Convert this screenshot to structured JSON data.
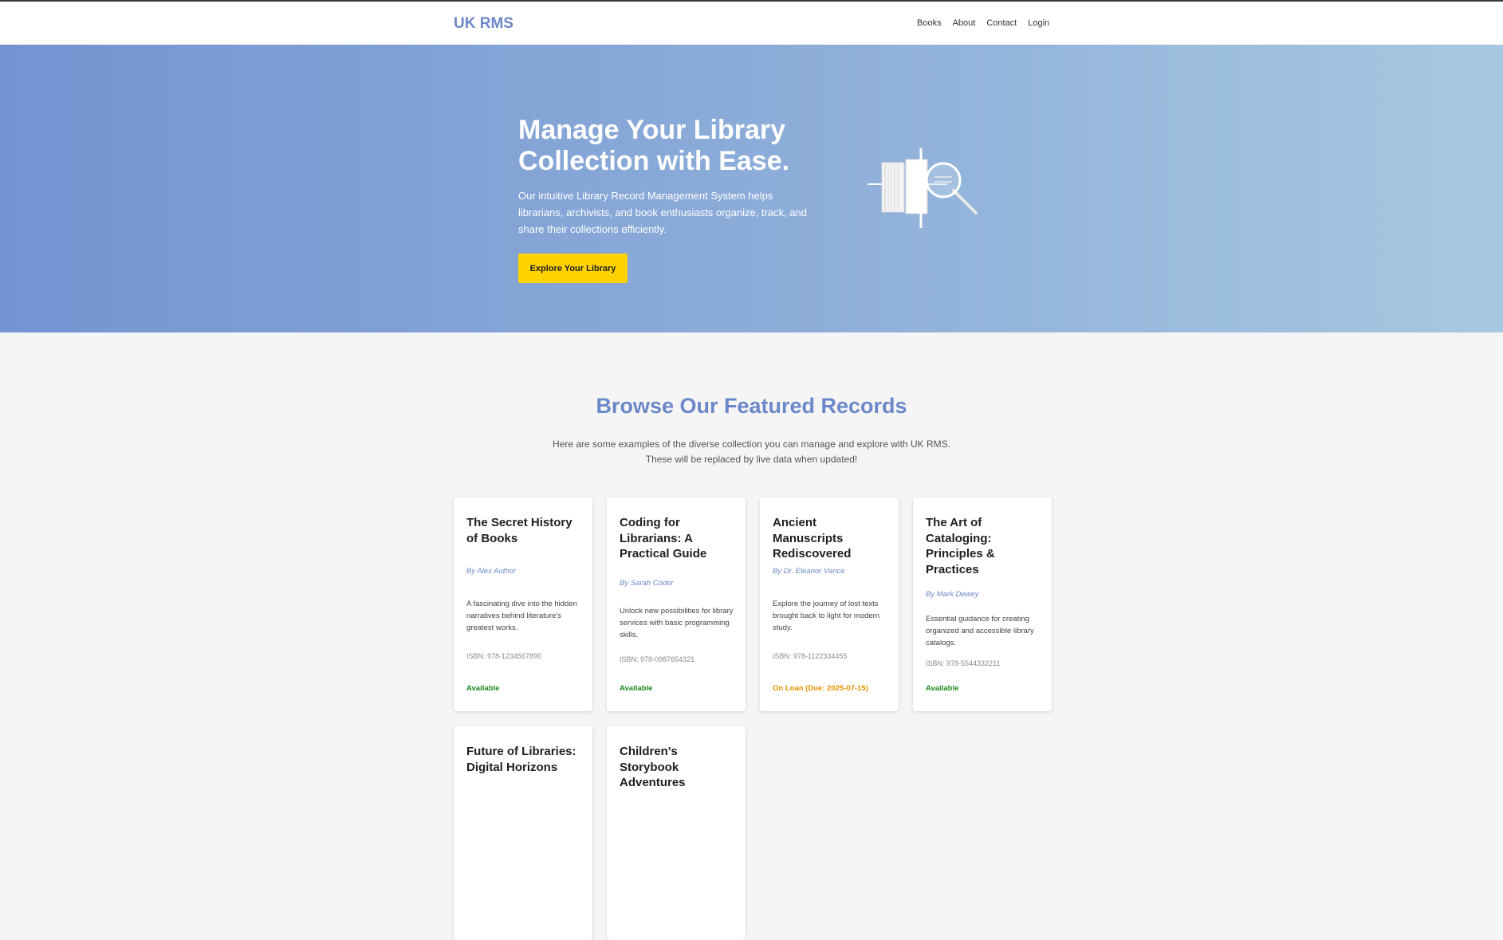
{
  "header": {
    "brand": "UK RMS",
    "nav": [
      "Books",
      "About",
      "Contact",
      "Login"
    ]
  },
  "hero": {
    "title": "Manage Your Library Collection with Ease.",
    "description": "Our intuitive Library Record Management System helps librarians, archivists, and book enthusiasts organize, track, and share their collections efficiently.",
    "cta_label": "Explore Your Library",
    "icon": "book-magnifier-icon"
  },
  "featured": {
    "title": "Browse Our Featured Records",
    "subtitle_line1": "Here are some examples of the diverse collection you can manage and explore with UK RMS.",
    "subtitle_line2": "These will be replaced by live data when updated!",
    "cards": [
      {
        "title": "The Secret History of Books",
        "author": "By Alex Author",
        "description": "A fascinating dive into the hidden narratives behind literature's greatest works.",
        "isbn": "ISBN: 978-1234567890",
        "status": "Available"
      },
      {
        "title": "Coding for Librarians: A Practical Guide",
        "author": "By Sarah Coder",
        "description": "Unlock new possibilities for library services with basic programming skills.",
        "isbn": "ISBN: 978-0987654321",
        "status": "Available"
      },
      {
        "title": "Ancient Manuscripts Rediscovered",
        "author": "By Dr. Eleanor Vance",
        "description": "Explore the journey of lost texts brought back to light for modern study.",
        "isbn": "ISBN: 978-1122334455",
        "status": "On Loan (Due: 2025-07-15)"
      },
      {
        "title": "The Art of Cataloging: Principles & Practices",
        "author": "By Mark Dewey",
        "description": "Essential guidance for creating organized and accessible library catalogs.",
        "isbn": "ISBN: 978-5544332211",
        "status": "Available"
      },
      {
        "title": "Future of Libraries: Digital Horizons"
      },
      {
        "title": "Children's Storybook Adventures"
      }
    ]
  },
  "colors": {
    "brand": "#6c88c8",
    "cta": "#ffd200",
    "available": "#1e8a1e",
    "on_loan": "#e69100"
  }
}
